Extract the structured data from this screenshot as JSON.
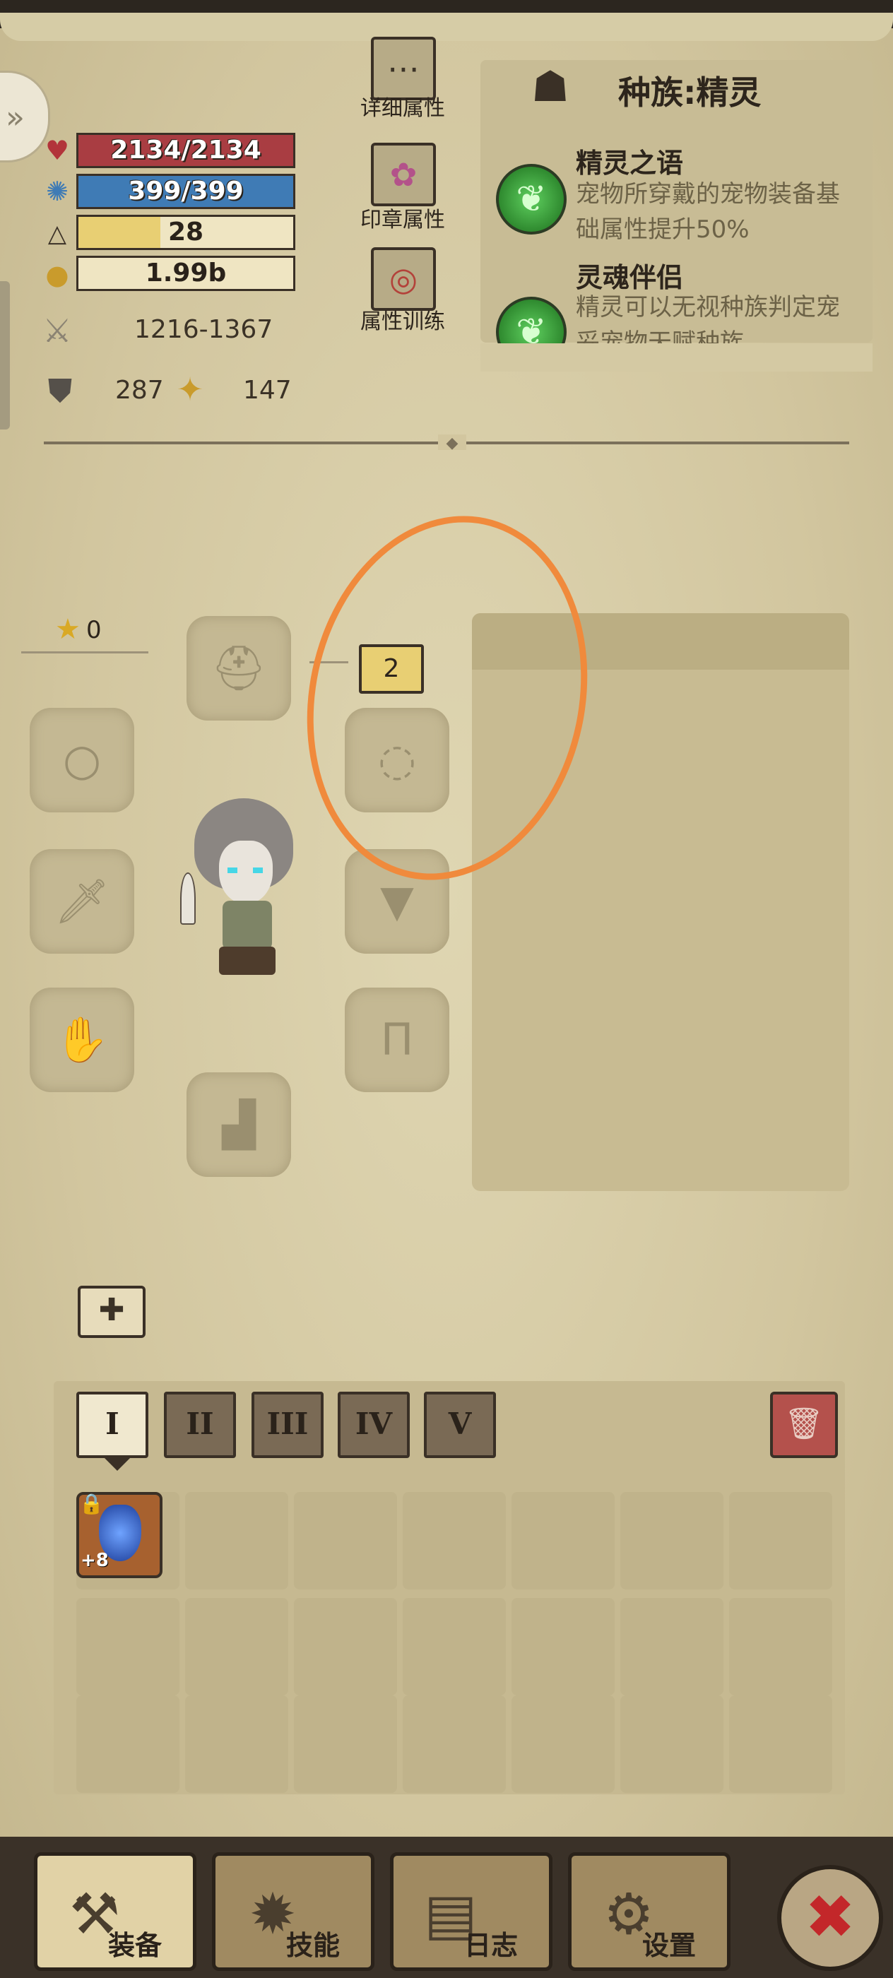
{
  "stats": {
    "hp": "2134/2134",
    "mp": "399/399",
    "level": "28",
    "gold": "1.99b",
    "attack": "1216-1367",
    "defense": "287",
    "magic": "147"
  },
  "menu_buttons": {
    "detail": "详细属性",
    "seal": "印章属性",
    "training": "属性训练"
  },
  "race": {
    "title": "种族:精灵",
    "skills": [
      {
        "name": "精灵之语",
        "desc": "宠物所穿戴的宠物装备基础属性提升50%"
      },
      {
        "name": "灵魂伴侣",
        "desc": "精灵可以无视种族判定宠妥宠物天赋种族"
      }
    ]
  },
  "equipment": {
    "stars": "0",
    "slot_level": "2"
  },
  "inventory": {
    "tabs": [
      "I",
      "II",
      "III",
      "IV",
      "V"
    ],
    "item_plus": "+8"
  },
  "nav": {
    "equip": "装备",
    "skill": "技能",
    "log": "日志",
    "settings": "设置"
  },
  "colors": {
    "hp_bar": "#a93d42",
    "mp_bar": "#3f7bb5",
    "level_bar": "#e8cf73",
    "highlight_circle": "#f08a3c"
  }
}
